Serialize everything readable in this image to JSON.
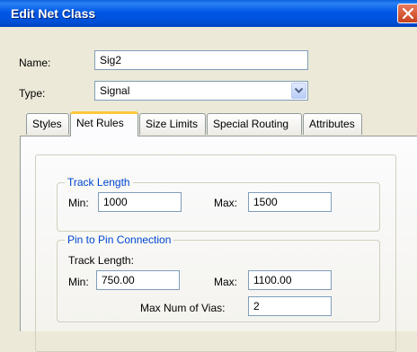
{
  "window": {
    "title": "Edit Net Class"
  },
  "form": {
    "name_label": "Name:",
    "name_value": "Sig2",
    "type_label": "Type:",
    "type_value": "Signal"
  },
  "tabs": [
    {
      "label": "Styles"
    },
    {
      "label": "Net Rules",
      "active": true
    },
    {
      "label": "Size Limits"
    },
    {
      "label": "Special Routing"
    },
    {
      "label": "Attributes"
    }
  ],
  "track_length": {
    "title": "Track Length",
    "min_label": "Min:",
    "min_value": "1000",
    "max_label": "Max:",
    "max_value": "1500"
  },
  "pin_to_pin": {
    "title": "Pin to Pin Connection",
    "subtitle": "Track Length:",
    "min_label": "Min:",
    "min_value": "750.00",
    "max_label": "Max:",
    "max_value": "1100.00",
    "vias_label": "Max Num of Vias:",
    "vias_value": "2"
  },
  "colors": {
    "titlebar": "#0058E6",
    "group_title": "#0046D5",
    "active_tab_accent": "#FFC83C",
    "face": "#ECE9D8"
  }
}
